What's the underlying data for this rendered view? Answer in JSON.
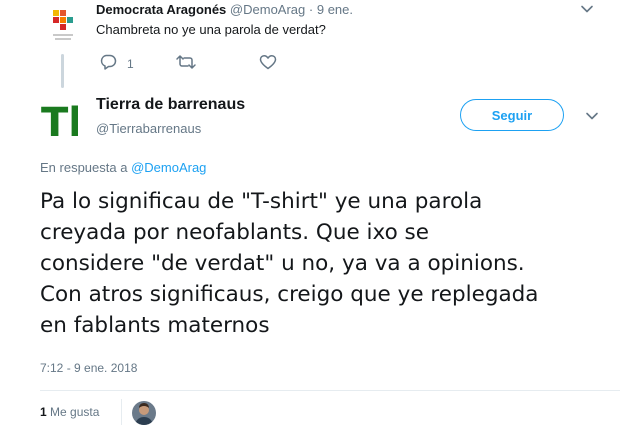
{
  "parent_tweet": {
    "author_name": "Democrata Aragonés",
    "handle": "@DemoArag",
    "date": "9 ene.",
    "text": "Chambreta no ye una parola de verdat?",
    "reply_count": "1"
  },
  "tweet": {
    "author_name": "Tierra de barrenaus",
    "handle": "@Tierrabarrenaus",
    "avatar_letters": "Tb",
    "follow_label": "Seguir",
    "reply_prefix": "En respuesta a",
    "reply_mention": "@DemoArag",
    "text_lines": [
      "Pa lo significau de \"T-shirt\" ye una parola",
      "creyada por neofablants. Que ixo se",
      "considere \"de verdat\" u no, ya va a opinions.",
      "Con atros significaus, creigo que ye replegada",
      "en fablants maternos"
    ],
    "timestamp": "7:12 - 9 ene. 2018",
    "like_count": "1",
    "like_label": "Me gusta"
  },
  "colors": {
    "accent": "#1da1f2",
    "secondary_text": "#657786",
    "primary_text": "#14171a",
    "avatar_green": "#1a7a1f"
  },
  "icons": [
    "logo-icon",
    "chevron-down-icon",
    "reply-icon",
    "retweet-icon",
    "heart-icon",
    "avatar"
  ]
}
